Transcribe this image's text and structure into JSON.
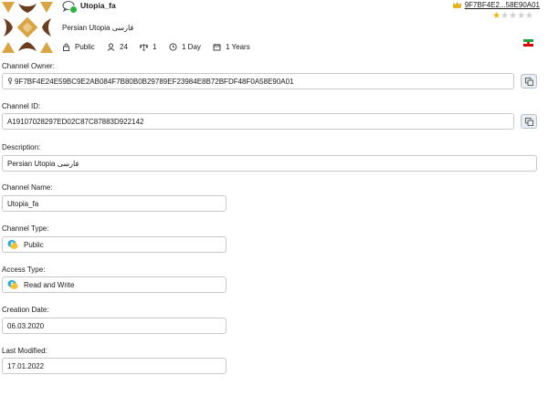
{
  "header": {
    "title": "Utopia_fa",
    "description": "Persian Utopia فارسی",
    "owner_short": "9F7BF4E2...58E90A01",
    "rating": 1,
    "rating_max": 5,
    "stats": {
      "visibility": "Public",
      "members": "24",
      "moderators": "1",
      "period": "1 Day",
      "age": "1 Years"
    }
  },
  "form": {
    "owner_label": "Channel Owner:",
    "owner_value": "9F7BF4E24E59BC9E2AB084F7B80B0B29789EF23984E8B72BFDF48F0A58E90A01",
    "id_label": "Channel ID:",
    "id_value": "A19107028297ED02C87C87883D922142",
    "description_label": "Description:",
    "description_value": "Persian Utopia فارسی",
    "name_label": "Channel Name:",
    "name_value": "Utopia_fa",
    "type_label": "Channel Type:",
    "type_value": "Public",
    "access_label": "Access Type:",
    "access_value": "Read and Write",
    "created_label": "Creation Date:",
    "created_value": "06.03.2020",
    "modified_label": "Last Modified:",
    "modified_value": "17.01.2022"
  },
  "colors": {
    "avatar_gold": "#d9a441",
    "avatar_brown": "#6b3d1e",
    "star_on": "#f0b400",
    "star_off": "#d0d0d0",
    "online": "#2ab53b",
    "flag_green": "#239f40",
    "flag_white": "#ffffff",
    "flag_red": "#da0000"
  },
  "icons": {
    "avatar": "channel-avatar-pattern",
    "chat": "chat-bubble-icon",
    "crown": "crown-icon",
    "flag": "iran-flag-icon",
    "copy": "copy-icon"
  }
}
